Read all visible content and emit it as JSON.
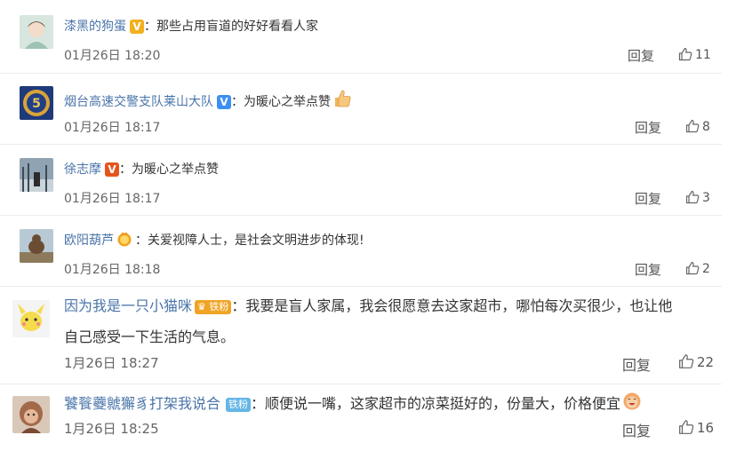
{
  "comments": [
    {
      "user": "漆黑的狗蛋",
      "sep": "：",
      "text": "那些占用盲道的好好看看人家",
      "time": "01月26日 18:20",
      "reply": "回复",
      "likes": "11"
    },
    {
      "user": "烟台高速交警支队莱山大队",
      "sep": "：",
      "text": "为暖心之举点赞",
      "time": "01月26日 18:17",
      "reply": "回复",
      "likes": "8"
    },
    {
      "user": "徐志摩",
      "sep": "：",
      "text": "为暖心之举点赞",
      "time": "01月26日 18:17",
      "reply": "回复",
      "likes": "3"
    },
    {
      "user": "欧阳葫芦",
      "sep": "：",
      "text": "关爱视障人士，是社会文明进步的体现!",
      "time": "01月26日 18:18",
      "reply": "回复",
      "likes": "2"
    },
    {
      "user": "因为我是一只小猫咪",
      "badge": "铁粉",
      "sep": "：",
      "text": "我要是盲人家属，我会很愿意去这家超市，哪怕每次买很少，也让他",
      "text2": "自己感受一下生活的气息。",
      "time": "1月26日 18:27",
      "reply": "回复",
      "likes": "22"
    },
    {
      "user": "饕餮虁虩獬豸打架我说合",
      "badge": "铁粉",
      "sep": "：",
      "text": "顺便说一嘴，这家超市的凉菜挺好的，份量大，价格便宜",
      "time": "1月26日 18:25",
      "reply": "回复",
      "likes": "16"
    }
  ],
  "colors": {
    "username": "#4a74a9",
    "gold_v": "#f2b01e",
    "blue_v": "#3d8ff2",
    "red_v": "#e5541c",
    "fan_badge": "#f0a425",
    "fan_badge2": "#63b6e6"
  }
}
